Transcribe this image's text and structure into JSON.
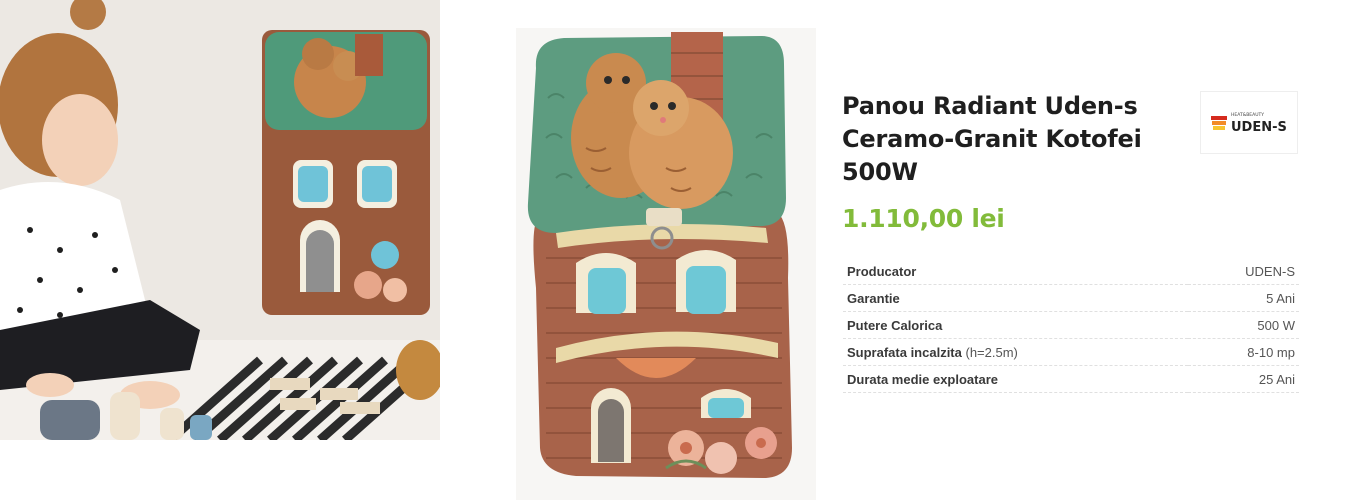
{
  "product": {
    "title": "Panou Radiant Uden-s Ceramo-Granit Kotofei 500W",
    "price": "1.110,00 lei"
  },
  "brand": {
    "tagline": "HEAT&BEAUTY",
    "name": "UDEN-S",
    "colors": {
      "red": "#d52b1e",
      "orange": "#f28c28",
      "yellow": "#f7c531"
    }
  },
  "specs": [
    {
      "label": "Producator",
      "note": "",
      "value": "UDEN-S"
    },
    {
      "label": "Garantie",
      "note": "",
      "value": "5 Ani"
    },
    {
      "label": "Putere Calorica",
      "note": "",
      "value": "500 W"
    },
    {
      "label": "Suprafata incalzita",
      "note": "(h=2.5m)",
      "value": "8-10 mp"
    },
    {
      "label": "Durata medie exploatare",
      "note": "",
      "value": "25 Ani"
    }
  ],
  "colors": {
    "price": "#82bb3a",
    "title": "#1f1f1f"
  }
}
